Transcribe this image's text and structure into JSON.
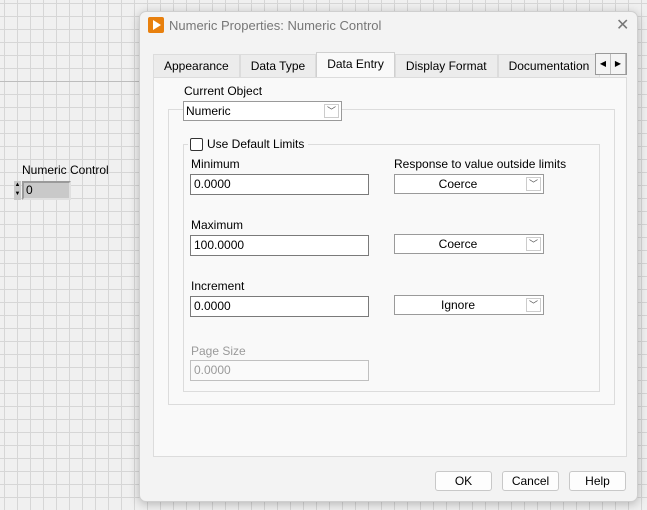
{
  "front_panel": {
    "control_label": "Numeric Control",
    "control_value": "0"
  },
  "dialog": {
    "title": "Numeric Properties: Numeric Control",
    "close_icon": "close-icon",
    "tabs": [
      {
        "label": "Appearance"
      },
      {
        "label": "Data Type"
      },
      {
        "label": "Data Entry",
        "active": true
      },
      {
        "label": "Display Format"
      },
      {
        "label": "Documentation"
      }
    ],
    "current_object": {
      "label": "Current Object",
      "value": "Numeric"
    },
    "use_default_limits": {
      "label": "Use Default Limits",
      "checked": false
    },
    "response_label": "Response to value outside limits",
    "minimum": {
      "label": "Minimum",
      "value": "0.0000",
      "response": "Coerce"
    },
    "maximum": {
      "label": "Maximum",
      "value": "100.0000",
      "response": "Coerce"
    },
    "increment": {
      "label": "Increment",
      "value": "0.0000",
      "response": "Ignore"
    },
    "page_size": {
      "label": "Page Size",
      "value": "0.0000",
      "disabled": true
    },
    "buttons": {
      "ok": "OK",
      "cancel": "Cancel",
      "help": "Help"
    },
    "accent": "#e8800e"
  }
}
